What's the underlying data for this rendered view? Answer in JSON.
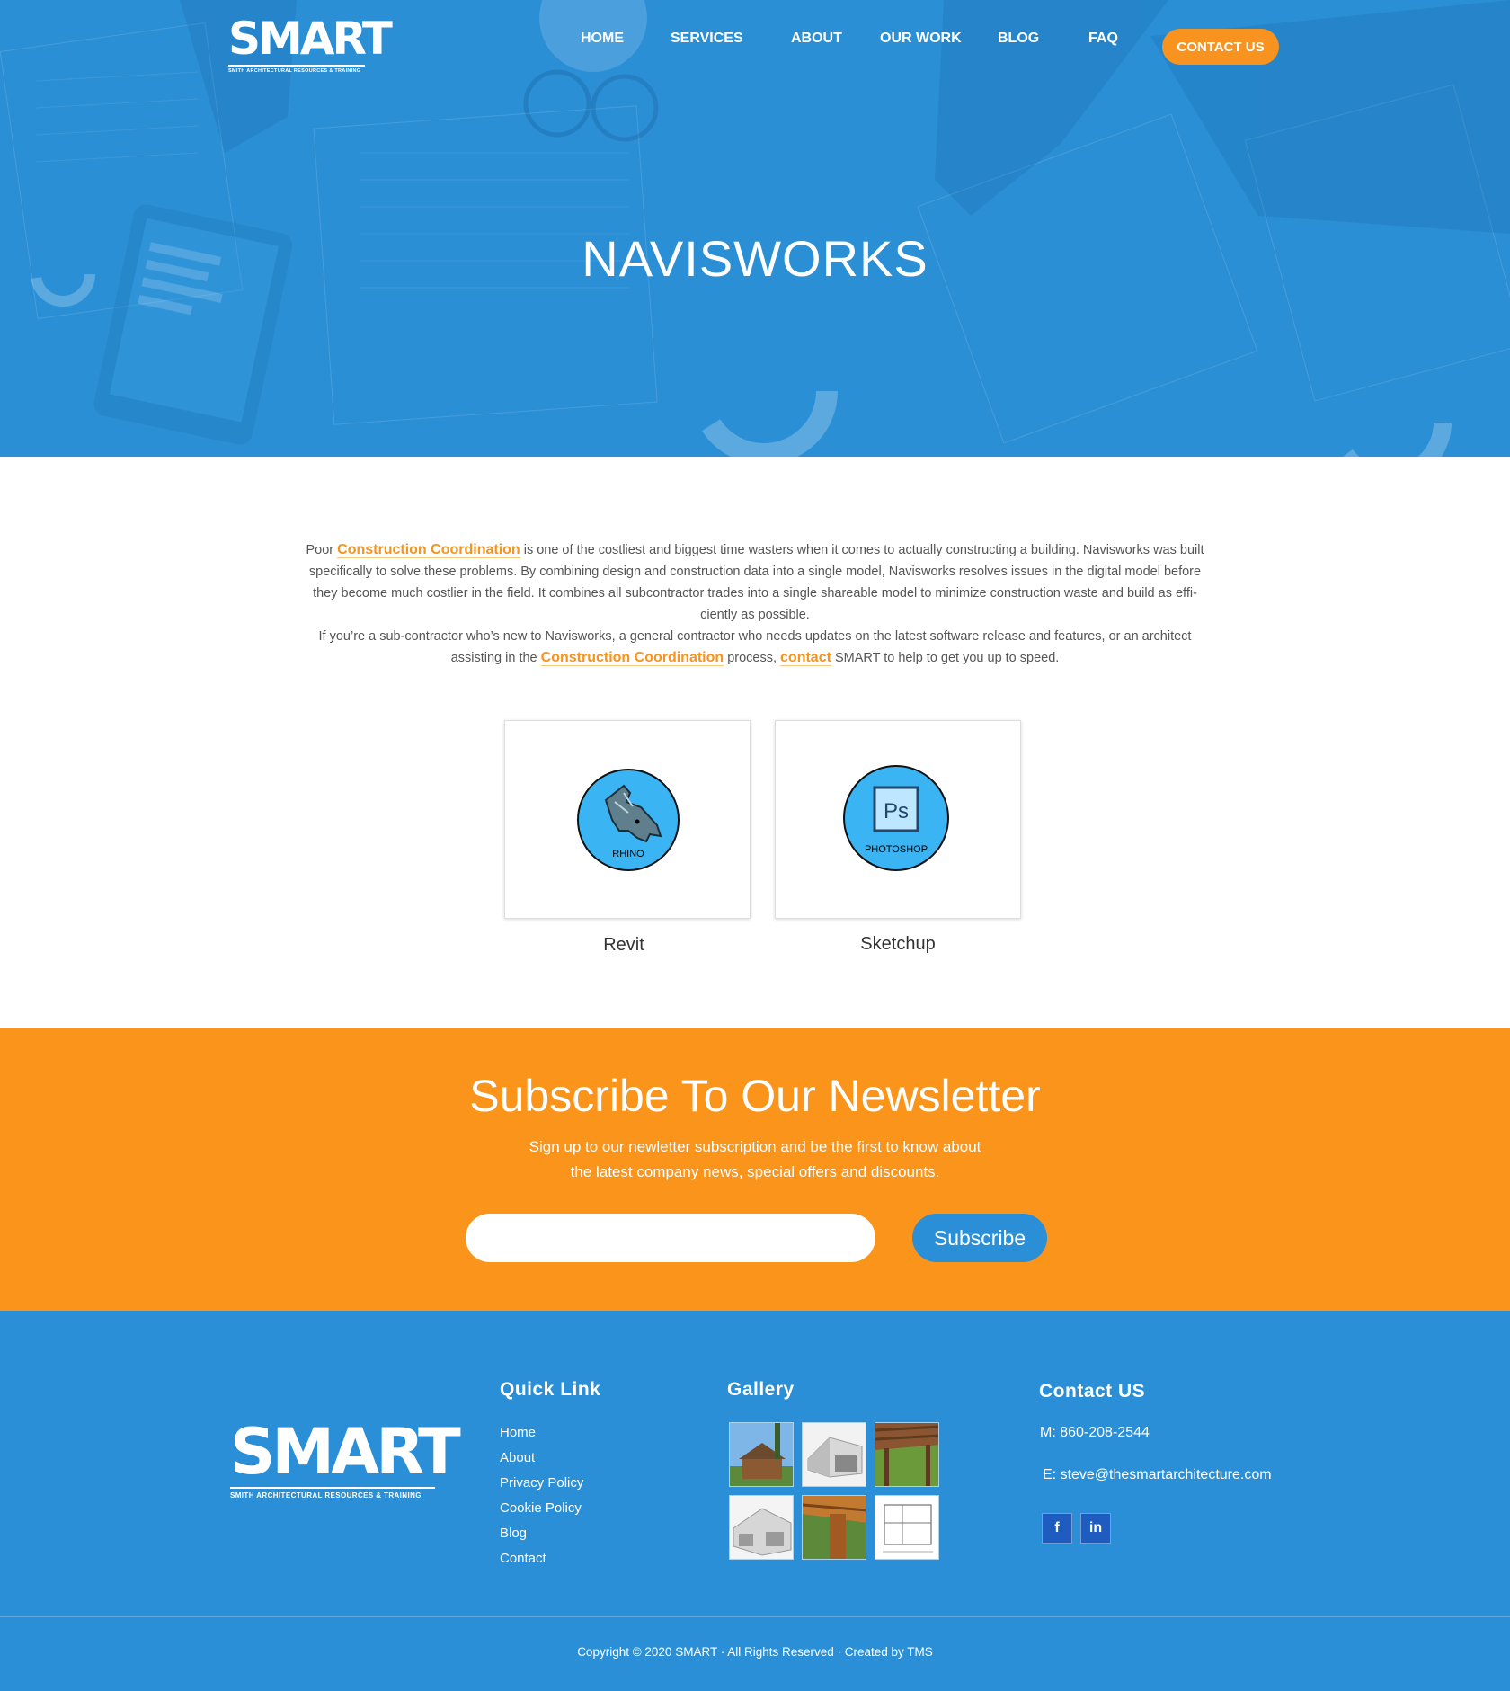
{
  "header": {
    "logo": {
      "word": "SMART",
      "subtitle": "SMITH ARCHITECTURAL RESOURCES & TRAINING"
    },
    "nav": [
      "HOME",
      "SERVICES",
      "ABOUT",
      "OUR WORK",
      "BLOG",
      "FAQ"
    ],
    "cta": "CONTACT US"
  },
  "hero": {
    "title": "NAVISWORKS"
  },
  "intro": {
    "p1_before": "Poor ",
    "p1_link": "Construction Coordination",
    "p1_after": " is one of the costliest and biggest time wasters when it comes to actually constructing a building. Navisworks was built specifically to solve these problems. By combining design and construction data into a single model, Navisworks resolves issues in the digital model before they become much costlier in the field. It combines all subcontractor trades into a single shareable model to minimize construction waste and build as effi-ciently as possible.",
    "p2_before": "If you’re a sub-contractor who’s new to Navisworks, a general contractor who needs updates on the latest software release and features, or an architect assisting in the ",
    "p2_link": "Construction Coordination",
    "p2_mid": " process, ",
    "p2_link2": "contact",
    "p2_after": "  SMART to help to get you up to speed."
  },
  "cards": [
    {
      "label": "Revit",
      "badge": "RHINO",
      "icon": "rhino-icon"
    },
    {
      "label": "Sketchup",
      "badge": "PHOTOSHOP",
      "icon": "photoshop-icon",
      "glyph": "Ps"
    }
  ],
  "newsletter": {
    "title": "Subscribe To Our Newsletter",
    "line1": "Sign up to our newletter subscription and be the first to know about",
    "line2": "the latest company news, special offers and discounts.",
    "input_value": "",
    "button": "Subscribe"
  },
  "footer": {
    "logo": {
      "word": "SMART",
      "subtitle": "SMITH ARCHITECTURAL RESOURCES & TRAINING"
    },
    "quick_link_heading": "Quick Link",
    "quick_links": [
      "Home",
      "About",
      "Privacy Policy",
      "Cookie Policy",
      "Blog",
      "Contact"
    ],
    "gallery_heading": "Gallery",
    "contact_heading": "Contact US",
    "phone": "M: 860-208-2544",
    "email": "E: steve@thesmartarchitecture.com",
    "social": [
      {
        "icon": "facebook-icon",
        "glyph": "f"
      },
      {
        "icon": "linkedin-icon",
        "glyph": "in"
      }
    ],
    "copyright": "Copyright © 2020 SMART · All Rights Reserved · Created by TMS"
  },
  "colors": {
    "blue": "#2a8fd6",
    "orange": "#fa941a",
    "white": "#ffffff"
  }
}
